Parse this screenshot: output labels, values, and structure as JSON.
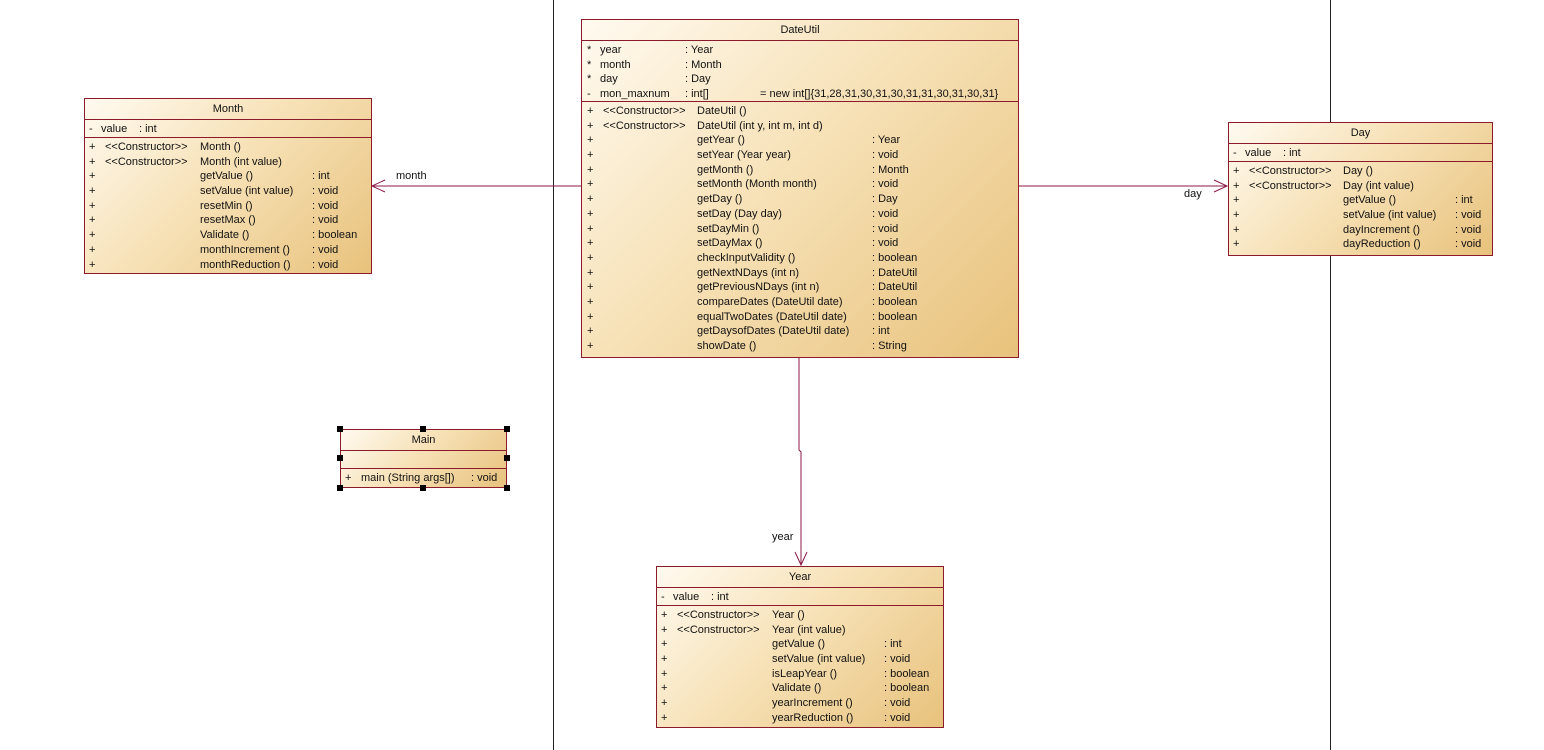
{
  "classes": {
    "dateutil": {
      "name": "DateUtil",
      "attributes": [
        {
          "vis": "*",
          "name": "year",
          "type": ": Year",
          "init": ""
        },
        {
          "vis": "*",
          "name": "month",
          "type": ": Month",
          "init": ""
        },
        {
          "vis": "*",
          "name": "day",
          "type": ": Day",
          "init": ""
        },
        {
          "vis": "-",
          "name": "mon_maxnum",
          "type": ": int[]",
          "init": "= new int[]{31,28,31,30,31,30,31,31,30,31,30,31}"
        }
      ],
      "operations": [
        {
          "vis": "+",
          "stereo": "<<Constructor>>",
          "name": "DateUtil ()",
          "type": ""
        },
        {
          "vis": "+",
          "stereo": "<<Constructor>>",
          "name": "DateUtil (int y, int m, int d)",
          "type": ""
        },
        {
          "vis": "+",
          "stereo": "",
          "name": "getYear ()",
          "type": ": Year"
        },
        {
          "vis": "+",
          "stereo": "",
          "name": "setYear (Year year)",
          "type": ": void"
        },
        {
          "vis": "+",
          "stereo": "",
          "name": "getMonth ()",
          "type": ": Month"
        },
        {
          "vis": "+",
          "stereo": "",
          "name": "setMonth (Month month)",
          "type": ": void"
        },
        {
          "vis": "+",
          "stereo": "",
          "name": "getDay ()",
          "type": ": Day"
        },
        {
          "vis": "+",
          "stereo": "",
          "name": "setDay (Day day)",
          "type": ": void"
        },
        {
          "vis": "+",
          "stereo": "",
          "name": "setDayMin ()",
          "type": ": void"
        },
        {
          "vis": "+",
          "stereo": "",
          "name": "setDayMax ()",
          "type": ": void"
        },
        {
          "vis": "+",
          "stereo": "",
          "name": "checkInputValidity ()",
          "type": ": boolean"
        },
        {
          "vis": "+",
          "stereo": "",
          "name": "getNextNDays (int n)",
          "type": ": DateUtil"
        },
        {
          "vis": "+",
          "stereo": "",
          "name": "getPreviousNDays (int n)",
          "type": ": DateUtil"
        },
        {
          "vis": "+",
          "stereo": "",
          "name": "compareDates (DateUtil date)",
          "type": ": boolean"
        },
        {
          "vis": "+",
          "stereo": "",
          "name": "equalTwoDates (DateUtil date)",
          "type": ": boolean"
        },
        {
          "vis": "+",
          "stereo": "",
          "name": "getDaysofDates (DateUtil date)",
          "type": ": int"
        },
        {
          "vis": "+",
          "stereo": "",
          "name": "showDate ()",
          "type": ": String"
        }
      ]
    },
    "month": {
      "name": "Month",
      "attributes": [
        {
          "vis": "-",
          "name": "value",
          "type": ": int",
          "init": ""
        }
      ],
      "operations": [
        {
          "vis": "+",
          "stereo": "<<Constructor>>",
          "name": "Month ()",
          "type": ""
        },
        {
          "vis": "+",
          "stereo": "<<Constructor>>",
          "name": "Month (int value)",
          "type": ""
        },
        {
          "vis": "+",
          "stereo": "",
          "name": "getValue ()",
          "type": ": int"
        },
        {
          "vis": "+",
          "stereo": "",
          "name": "setValue (int value)",
          "type": ": void"
        },
        {
          "vis": "+",
          "stereo": "",
          "name": "resetMin ()",
          "type": ": void"
        },
        {
          "vis": "+",
          "stereo": "",
          "name": "resetMax ()",
          "type": ": void"
        },
        {
          "vis": "+",
          "stereo": "",
          "name": "Validate ()",
          "type": ": boolean"
        },
        {
          "vis": "+",
          "stereo": "",
          "name": "monthIncrement ()",
          "type": ": void"
        },
        {
          "vis": "+",
          "stereo": "",
          "name": "monthReduction ()",
          "type": ": void"
        }
      ]
    },
    "day": {
      "name": "Day",
      "attributes": [
        {
          "vis": "-",
          "name": "value",
          "type": ": int",
          "init": ""
        }
      ],
      "operations": [
        {
          "vis": "+",
          "stereo": "<<Constructor>>",
          "name": "Day ()",
          "type": ""
        },
        {
          "vis": "+",
          "stereo": "<<Constructor>>",
          "name": "Day (int value)",
          "type": ""
        },
        {
          "vis": "+",
          "stereo": "",
          "name": "getValue ()",
          "type": ": int"
        },
        {
          "vis": "+",
          "stereo": "",
          "name": "setValue (int value)",
          "type": ": void"
        },
        {
          "vis": "+",
          "stereo": "",
          "name": "dayIncrement ()",
          "type": ": void"
        },
        {
          "vis": "+",
          "stereo": "",
          "name": "dayReduction ()",
          "type": ": void"
        }
      ]
    },
    "year": {
      "name": "Year",
      "attributes": [
        {
          "vis": "-",
          "name": "value",
          "type": ": int",
          "init": ""
        }
      ],
      "operations": [
        {
          "vis": "+",
          "stereo": "<<Constructor>>",
          "name": "Year ()",
          "type": ""
        },
        {
          "vis": "+",
          "stereo": "<<Constructor>>",
          "name": "Year (int value)",
          "type": ""
        },
        {
          "vis": "+",
          "stereo": "",
          "name": "getValue ()",
          "type": ": int"
        },
        {
          "vis": "+",
          "stereo": "",
          "name": "setValue (int value)",
          "type": ": void"
        },
        {
          "vis": "+",
          "stereo": "",
          "name": "isLeapYear ()",
          "type": ": boolean"
        },
        {
          "vis": "+",
          "stereo": "",
          "name": "Validate ()",
          "type": ": boolean"
        },
        {
          "vis": "+",
          "stereo": "",
          "name": "yearIncrement ()",
          "type": ": void"
        },
        {
          "vis": "+",
          "stereo": "",
          "name": "yearReduction ()",
          "type": ": void"
        }
      ]
    },
    "main": {
      "name": "Main",
      "attributes": [],
      "operations": [
        {
          "vis": "+",
          "stereo": "",
          "name": "main (String args[])",
          "type": ": void"
        }
      ]
    }
  },
  "associations": {
    "month": "month",
    "day": "day",
    "year": "year"
  },
  "colors": {
    "border": "#8b1a2a",
    "line": "#8b1a4a"
  }
}
